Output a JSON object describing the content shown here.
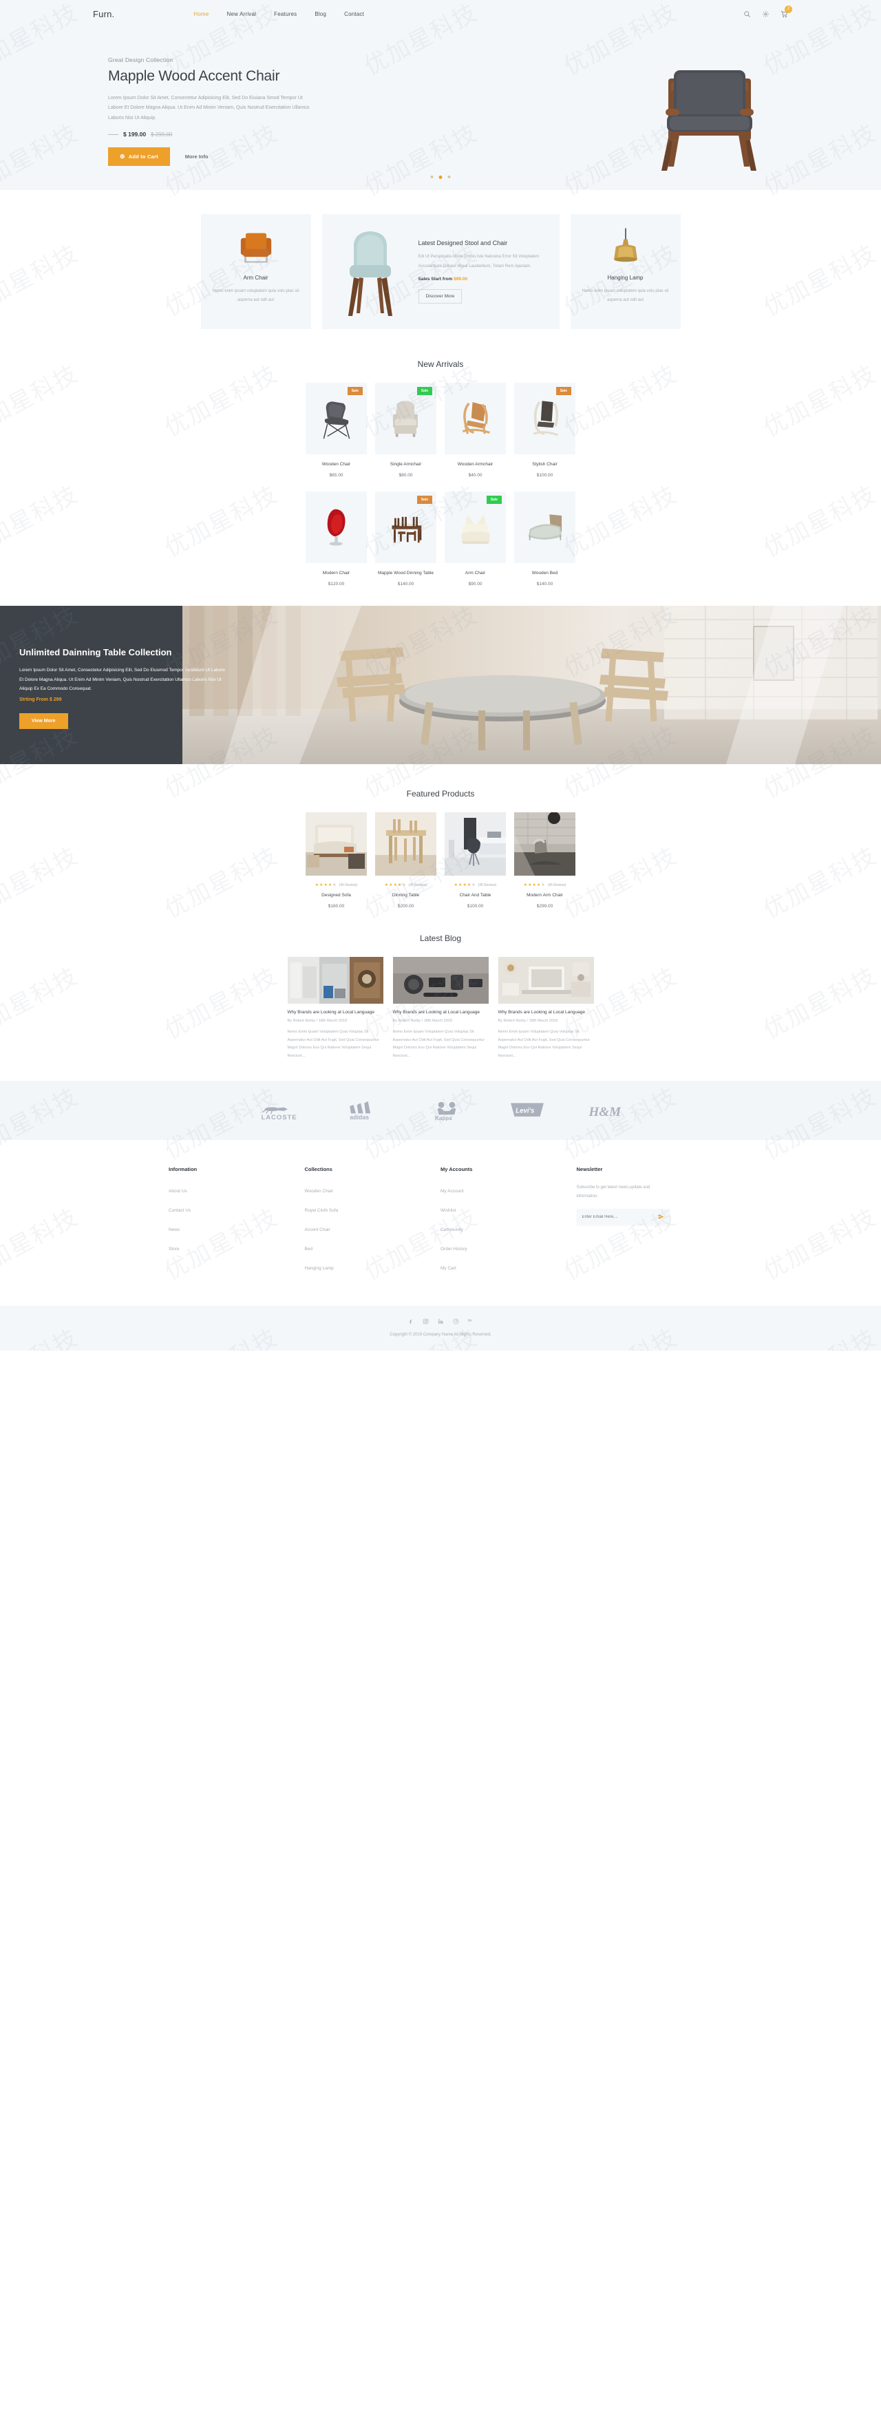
{
  "watermark": "优加星科技",
  "header": {
    "logo": "Furn.",
    "nav": [
      {
        "label": "Home",
        "active": true
      },
      {
        "label": "New Arrival",
        "active": false
      },
      {
        "label": "Features",
        "active": false
      },
      {
        "label": "Blog",
        "active": false
      },
      {
        "label": "Contact",
        "active": false
      }
    ],
    "icons": [
      {
        "name": "search-icon"
      },
      {
        "name": "gear-icon"
      },
      {
        "name": "cart-icon"
      }
    ],
    "cart_count": "2"
  },
  "hero": {
    "kicker": "Great Design Collection",
    "title": "Mapple Wood Accent Chair",
    "description": "Lorem Ipsum Dolor Sit Amet, Consectetur Adipisicing Elit, Sed Do Eiuiana Smod Tempor Ut Labore Et Dolore Magna Aliqua. Ut Enim Ad Minim Veniam, Quis Nostrud Exercitation Ullamco Laboris Nisi Ut Aliquip.",
    "price": "$ 199.00",
    "old_price": "$ 299.00",
    "cta_primary": "Add to Cart",
    "cta_secondary": "More Info",
    "slides": 3,
    "active_slide": 2
  },
  "features": {
    "left_card": {
      "name": "Arm Chair",
      "description": "Nemo enim ipsam voluptatem quia volu ptas sit asperna aut odit aut"
    },
    "center_card": {
      "title": "Latest Designed Stool and Chair",
      "description": "Edi Ut Perspiciatis Unde Omnis Iste Natusina Error Sit Voluptatem Accusantium Doloret Mque Laudantium, Totam Rem Aperiam.",
      "sales_label": "Sales Start from ",
      "sales_price": "$99.00",
      "button": "Discover More"
    },
    "right_card": {
      "name": "Hanging Lamp",
      "description": "Nemo enim ipsam voluptatem quia volu ptas sit asperna aut odit aut"
    }
  },
  "new_arrivals": {
    "title": "New Arrivals",
    "products": [
      {
        "name": "Wooden Chair",
        "price": "$65.00",
        "badge": "Sale",
        "badge_color": "orange",
        "img": "grey-lounge-chair"
      },
      {
        "name": "Single Armchair",
        "price": "$80.00",
        "badge": "Sale",
        "badge_color": "green",
        "img": "beige-wing-armchair"
      },
      {
        "name": "Wooden Armchair",
        "price": "$40.00",
        "badge": "",
        "badge_color": "",
        "img": "wood-rocking-chair"
      },
      {
        "name": "Stylish Chair",
        "price": "$100.00",
        "badge": "Sale",
        "badge_color": "orange",
        "img": "dark-lounge-chair"
      },
      {
        "name": "Modern Chair",
        "price": "$120.00",
        "badge": "",
        "badge_color": "",
        "img": "red-egg-chair"
      },
      {
        "name": "Mapple Wood Dinning Table",
        "price": "$140.00",
        "badge": "Sale",
        "badge_color": "orange",
        "img": "dining-set"
      },
      {
        "name": "Arm Chair",
        "price": "$90.00",
        "badge": "Sale",
        "badge_color": "green",
        "img": "cream-sofa-chair"
      },
      {
        "name": "Wooden Bed",
        "price": "$140.00",
        "badge": "",
        "badge_color": "",
        "img": "wooden-bed"
      }
    ]
  },
  "banner": {
    "title": "Unlimited Dainning Table Collection",
    "description": "Lorem Ipsum Dolor Sit Amet, Consectetur Adipisicing Elit, Sed Do Eiusmod Tempor Incididunt Ut Labore Et Dolore Magna Aliqua. Ut Enim Ad Minim Veniam, Quis Nostrud Exercitation Ullamco Laboris Nisi Ut Aliquip Ex Ea Commodo Consequat.",
    "starting_label": "Strting From ",
    "starting_price": "$ 299",
    "button": "View More"
  },
  "featured": {
    "title": "Featured Products",
    "products": [
      {
        "name": "Designed Sofa",
        "price": "$160.00",
        "rating": 4,
        "reviews": "(45 Review)"
      },
      {
        "name": "Dinning Table",
        "price": "$200.00",
        "rating": 4,
        "reviews": "(45 Review)"
      },
      {
        "name": "Chair And Table",
        "price": "$100.00",
        "rating": 4,
        "reviews": "(45 Review)"
      },
      {
        "name": "Modern Arm Chair",
        "price": "$299.00",
        "rating": 4,
        "reviews": "(45 Review)"
      }
    ]
  },
  "blog": {
    "title": "Latest Blog",
    "posts": [
      {
        "title": "Why Brands are Looking at Local Language",
        "meta": "By Robert Norby / 18th March 2018",
        "excerpt": "Nemo Enim Ipsam Voluptatem Quia Voluptas Sit Aspernatur Aut Odit Aut Fugit, Sed Quia Consequuntur Magni Dolores Eos Qui Ratione Voluptatem Sequi Nesciunt..."
      },
      {
        "title": "Why Brands are Looking at Local Language",
        "meta": "By Robert Norby / 18th March 2018",
        "excerpt": "Nemo Enim Ipsam Voluptatem Quia Voluptas Sit Aspernatur Aut Odit Aut Fugit, Sed Quia Consequuntur Magni Dolores Eos Qui Ratione Voluptatem Sequi Nesciunt..."
      },
      {
        "title": "Why Brands are Looking at Local Language",
        "meta": "By Robert Norby / 18th March 2018",
        "excerpt": "Nemo Enim Ipsam Voluptatem Quia Voluptas Sit Aspernatur Aut Odit Aut Fugit, Sed Quia Consequuntur Magni Dolores Eos Qui Ratione Voluptatem Sequi Nesciunt..."
      }
    ]
  },
  "brands": [
    "LACOSTE",
    "adidas",
    "Kappa",
    "Levi's",
    "H&M"
  ],
  "footer": {
    "columns": [
      {
        "heading": "Information",
        "links": [
          "About Us",
          "Contact Us",
          "News",
          "Store"
        ]
      },
      {
        "heading": "Collections",
        "links": [
          "Wooden Chair",
          "Royal Cloth Sofa",
          "Accent Chair",
          "Bed",
          "Hanging Lamp"
        ]
      },
      {
        "heading": "My Accounts",
        "links": [
          "My Account",
          "Wishlist",
          "Community",
          "Order History",
          "My Cart"
        ]
      }
    ],
    "newsletter": {
      "heading": "Newsletter",
      "text": "Subscribe to get latest news,update and information.",
      "placeholder": "Enter Email Here....",
      "value": ""
    },
    "socials": [
      "facebook-icon",
      "instagram-icon",
      "linkedin-icon",
      "pinterest-icon",
      "behance-icon"
    ],
    "copyright": "Copyright © 2019 Company Name All Rights Reserved."
  },
  "colors": {
    "accent": "#eda02a",
    "hero_bg": "#f4f7fa",
    "card_bg": "#f3f7fa",
    "dark": "#3d4349",
    "sale_orange": "#d98a3d",
    "sale_green": "#2fcc4f"
  }
}
